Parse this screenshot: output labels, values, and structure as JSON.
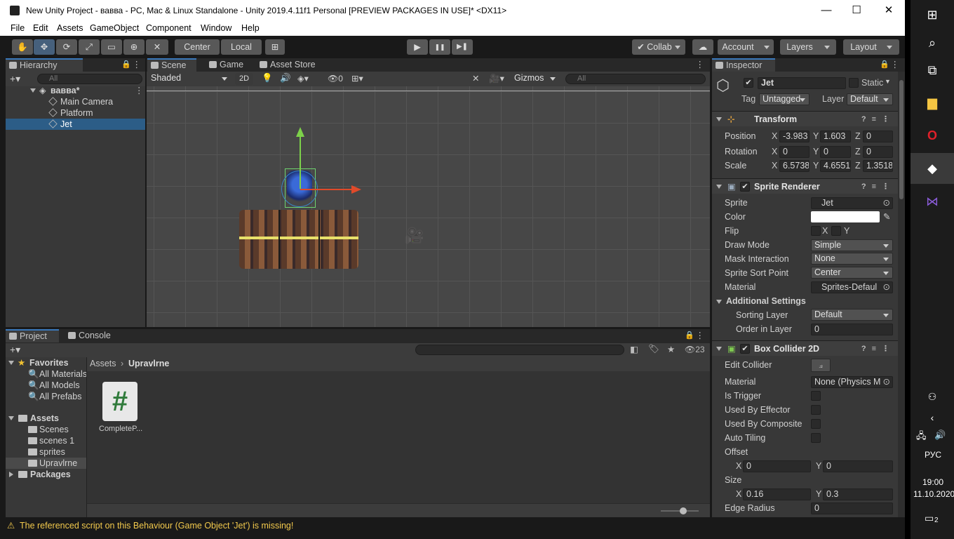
{
  "titlebar": {
    "title": "New Unity Project - вавва - PC, Mac & Linux Standalone - Unity 2019.4.11f1 Personal [PREVIEW PACKAGES IN USE]* <DX11>",
    "min": "—",
    "max": "☐",
    "close": "✕"
  },
  "menu": [
    "File",
    "Edit",
    "Assets",
    "GameObject",
    "Component",
    "Window",
    "Help"
  ],
  "toolbar": {
    "center": "Center",
    "local": "Local",
    "collab": "Collab",
    "account": "Account",
    "layers": "Layers",
    "layout": "Layout",
    "play": "▶",
    "pause": "❚❚",
    "step": "▶❚"
  },
  "hierarchy": {
    "tab": "Hierarchy",
    "search": "All",
    "scene": "вавва*",
    "items": [
      "Main Camera",
      "Platform",
      "Jet"
    ],
    "selected": "Jet"
  },
  "scene": {
    "tabs": [
      "Scene",
      "Game",
      "Asset Store"
    ],
    "shading": "Shaded",
    "mode2d": "2D",
    "hidden_count": "0",
    "gizmos": "Gizmos",
    "search": "All"
  },
  "project": {
    "tabs": [
      "Project",
      "Console"
    ],
    "favorites_label": "Favorites",
    "favorites": [
      "All Materials",
      "All Models",
      "All Prefabs"
    ],
    "assets_label": "Assets",
    "asset_folders": [
      "Scenes",
      "scenes 1",
      "sprites",
      "Upravlrne"
    ],
    "selected_folder": "Upravlrne",
    "packages_label": "Packages",
    "breadcrumb": [
      "Assets",
      "Upravlrne"
    ],
    "file_name": "CompleteP...",
    "file_glyph": "#",
    "hidden_count": "23"
  },
  "inspector": {
    "tab": "Inspector",
    "object_name": "Jet",
    "static_label": "Static",
    "tag_label": "Tag",
    "tag": "Untagged",
    "layer_label": "Layer",
    "layer": "Default",
    "transform": {
      "title": "Transform",
      "rows": [
        {
          "label": "Position",
          "x": "-3.983",
          "y": "1.603",
          "z": "0"
        },
        {
          "label": "Rotation",
          "x": "0",
          "y": "0",
          "z": "0"
        },
        {
          "label": "Scale",
          "x": "6.5738",
          "y": "4.6551",
          "z": "1.3518"
        }
      ]
    },
    "sprite_renderer": {
      "title": "Sprite Renderer",
      "sprite_label": "Sprite",
      "sprite": "Jet",
      "color_label": "Color",
      "color": "#ffffff",
      "flip_label": "Flip",
      "flip_x": "X",
      "flip_y": "Y",
      "draw_mode_label": "Draw Mode",
      "draw_mode": "Simple",
      "mask_label": "Mask Interaction",
      "mask": "None",
      "sort_point_label": "Sprite Sort Point",
      "sort_point": "Center",
      "material_label": "Material",
      "material": "Sprites-Defaul",
      "additional": "Additional Settings",
      "sorting_layer_label": "Sorting Layer",
      "sorting_layer": "Default",
      "order_label": "Order in Layer",
      "order": "0"
    },
    "box_collider": {
      "title": "Box Collider 2D",
      "edit_label": "Edit Collider",
      "material_label": "Material",
      "material": "None (Physics M",
      "is_trigger": "Is Trigger",
      "effector": "Used By Effector",
      "composite": "Used By Composite",
      "auto_tiling": "Auto Tiling",
      "offset_label": "Offset",
      "offset_x": "0",
      "offset_y": "0",
      "size_label": "Size",
      "size_x": "0.16",
      "size_y": "0.3",
      "edge_label": "Edge Radius",
      "edge": "0"
    }
  },
  "status": {
    "message": "The referenced script on this Behaviour (Game Object 'Jet') is missing!"
  },
  "taskbar": {
    "lang": "РУС",
    "time": "19:00",
    "date": "11.10.2020",
    "notif": "2"
  }
}
